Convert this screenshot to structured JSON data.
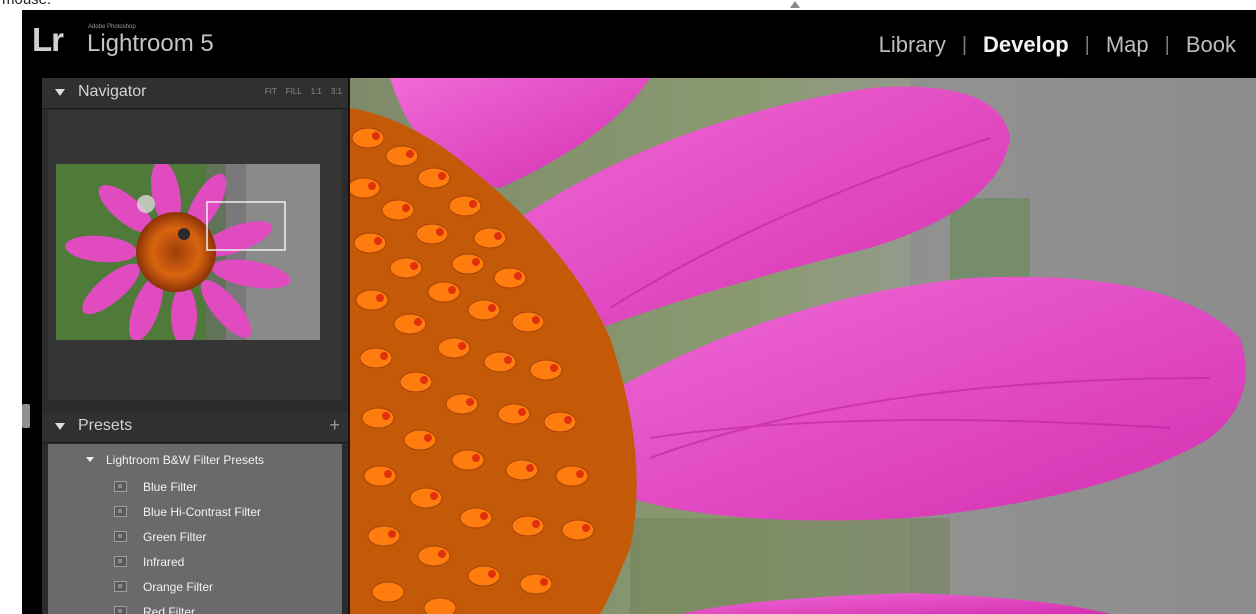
{
  "top_fragment": {
    "text": "mouse."
  },
  "app": {
    "logo": "Lr",
    "adobe_label": "Adobe Photoshop",
    "product_name": "Lightroom 5"
  },
  "modules": {
    "items": [
      "Library",
      "Develop",
      "Map",
      "Book"
    ],
    "active": "Develop"
  },
  "navigator": {
    "title": "Navigator",
    "zoom_options": [
      "FIT",
      "FILL",
      "1:1",
      "3:1"
    ]
  },
  "presets": {
    "title": "Presets",
    "add_symbol": "+",
    "folder": "Lightroom B&W Filter Presets",
    "items": [
      "Blue Filter",
      "Blue Hi-Contrast Filter",
      "Green Filter",
      "Infrared",
      "Orange Filter",
      "Red Filter"
    ]
  },
  "colors": {
    "petal_pink": "#e23fbf",
    "cone_orange": "#ff7a0a",
    "background_gray": "#8c8c8c",
    "panel_dark": "#2b2b2b",
    "presets_body": "#6a6a6a"
  }
}
